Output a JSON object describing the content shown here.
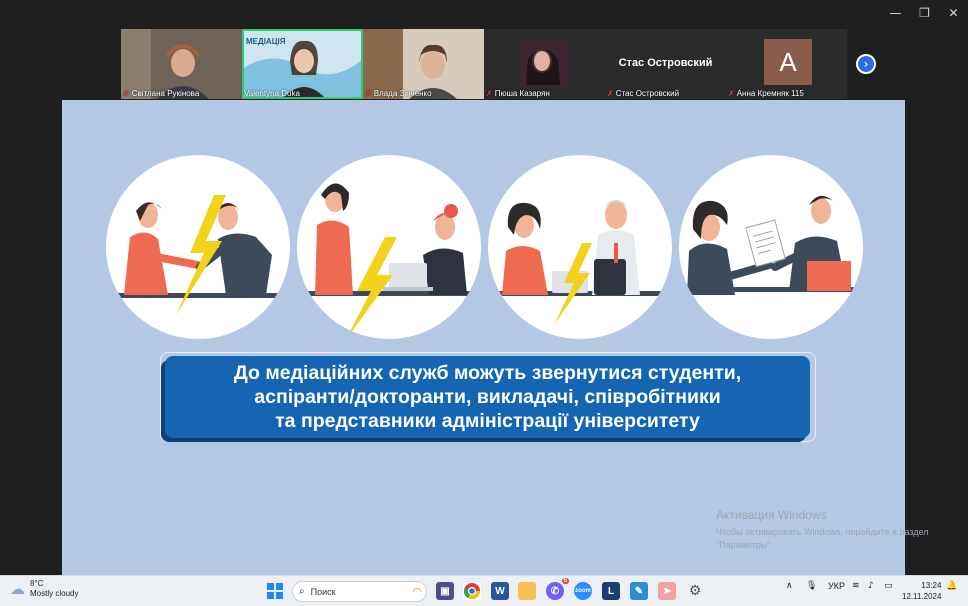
{
  "window_controls": {
    "minimize": "—",
    "restore": "❐",
    "close": "✕"
  },
  "participants": [
    {
      "name": "Світлана Рукінова",
      "mic_off": true,
      "kind": "video",
      "bg": "#7b6a5d"
    },
    {
      "name": "Valentyna Duka",
      "mic_off": false,
      "kind": "video",
      "bg": "#9ccbe0",
      "active": true,
      "overlay": "МЕДІАЦІЯ"
    },
    {
      "name": "Влада Зінченко",
      "mic_off": true,
      "kind": "video",
      "bg": "#a38a73"
    },
    {
      "name": "Пюша Казарян",
      "mic_off": true,
      "kind": "photo",
      "bg": "#2b2b2b"
    },
    {
      "name": "Стас Островский",
      "mic_off": true,
      "kind": "name",
      "display": "Стас Островский"
    },
    {
      "name": "Анна Кремняк 115",
      "mic_off": true,
      "kind": "avatar",
      "initial": "А"
    }
  ],
  "next_page_icon": "chevron-right-icon",
  "slide": {
    "banner_lines": [
      "До медіаційних служб можуть звернутися студенти,",
      "аспіранти/докторанти, викладачі, співробітники",
      "та представники адміністрації університету"
    ],
    "banner_color": "#1565b3"
  },
  "watermark": {
    "title": "Активация Windows",
    "line1": "Чтобы активировать Windows, перейдите в раздел",
    "line2": "\"Параметры\"."
  },
  "taskbar": {
    "weather_temp": "8°C",
    "weather_desc": "Mostly cloudy",
    "search_placeholder": "Поиск",
    "language": "УКР",
    "time": "13:24",
    "date": "12.11.2024",
    "badge_count": "5"
  }
}
